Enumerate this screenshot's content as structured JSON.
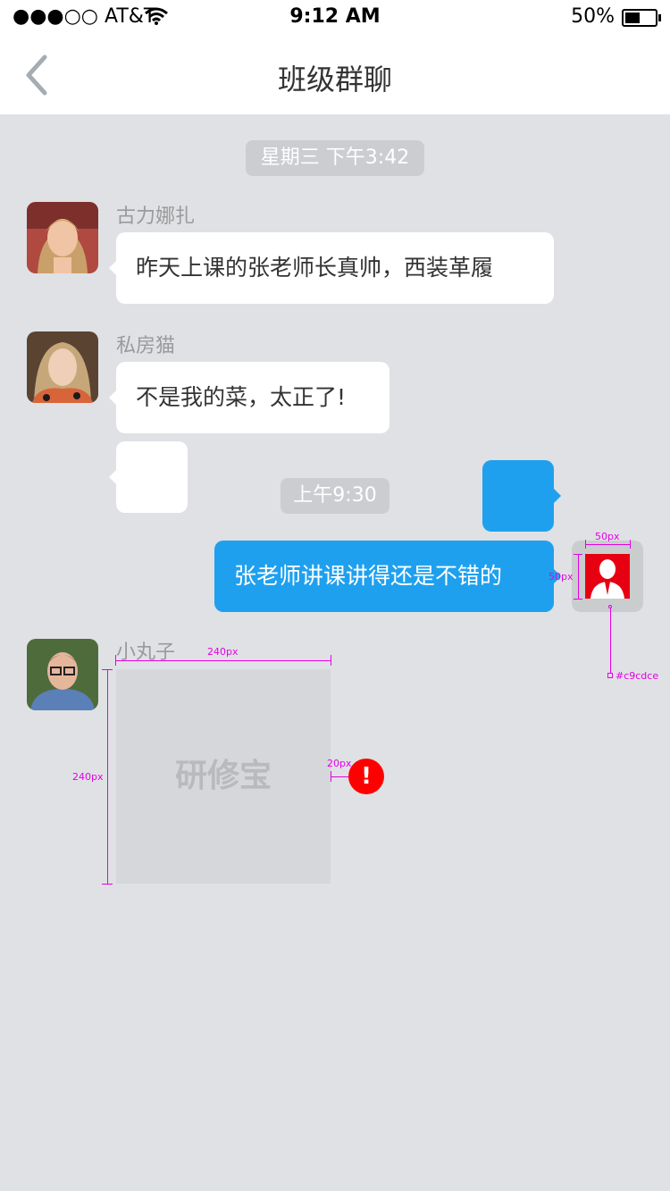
{
  "status_bar": {
    "carrier": "●●●○○ AT&T",
    "time": "9:12 AM",
    "battery": "50%",
    "battery_level": 0.5
  },
  "nav": {
    "title": "班级群聊",
    "back_icon": "chevron-left-icon"
  },
  "timestamps": {
    "first": "星期三 下午3:42",
    "second": "上午9:30"
  },
  "messages": {
    "m1": {
      "sender": "古力娜扎",
      "text": "昨天上课的张老师长真帅，西装革履"
    },
    "m2": {
      "sender": "私房猫",
      "text": "不是我的菜，太正了!"
    },
    "m3": {
      "text": "张老师讲课讲得还是不错的"
    },
    "m4": {
      "sender": "小丸子",
      "image_placeholder": "研修宝",
      "error_icon": "!"
    }
  },
  "annotations": {
    "w50": "50px",
    "h50": "50px",
    "color_swatch": "#c9cdce",
    "w240": "240px",
    "h240": "240px",
    "gap20": "20px"
  },
  "colors": {
    "bubble_mine": "#1fa0ee",
    "bubble_other": "#ffffff",
    "background": "#dfe1e5",
    "error": "#ff0000",
    "annotation": "#e600e6"
  }
}
